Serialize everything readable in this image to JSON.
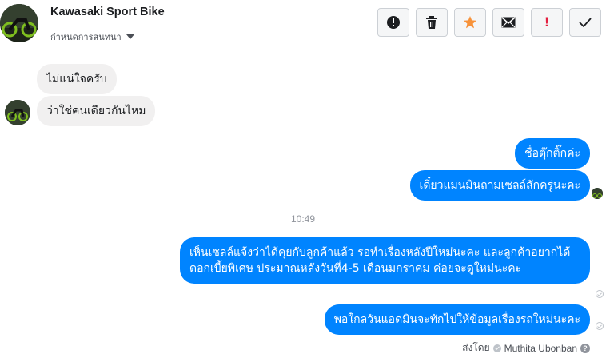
{
  "header": {
    "title": "Kawasaki Sport Bike",
    "subtitle": "กำหนดการสนทนา"
  },
  "actions": [
    {
      "name": "mark-spam",
      "icon": "alert-circle-icon"
    },
    {
      "name": "delete",
      "icon": "trash-icon"
    },
    {
      "name": "star",
      "icon": "star-icon"
    },
    {
      "name": "mark-unread",
      "icon": "envelope-icon"
    },
    {
      "name": "important",
      "icon": "exclamation-icon",
      "label": "!"
    },
    {
      "name": "done",
      "icon": "check-icon"
    }
  ],
  "messages": {
    "in_1": "ไม่แน่ใจครับ",
    "in_2": "ว่าใช่คนเดียวกันไหม",
    "out_1": "ชื่อตุ๊กติ๊กค่ะ",
    "out_2": "เดี๋ยวแมนมินถามเซลล์สักครู่นะคะ",
    "timestamp": "10:49",
    "out_3": "เห็นเซลล์แจ้งว่าได้คุยกับลูกค้าแล้ว รอทำเรื่องหลังปีใหม่นะคะ และลูกค้าอยากได้ดอกเบี้ยพิเศษ ประมาณหลังวันที่4-5 เดือนมกราคม ค่อยจะดูใหม่นะคะ",
    "out_4": "พอใกลวันแอดมินจะทักไปให้ข้อมูลเรื่องรถใหม่นะคะ"
  },
  "sent_by": {
    "prefix": "ส่งโดย",
    "name": "Muthita Ubonban"
  },
  "colors": {
    "outgoing": "#0084ff",
    "incoming": "#f1f0f0",
    "star": "#f7923a"
  }
}
